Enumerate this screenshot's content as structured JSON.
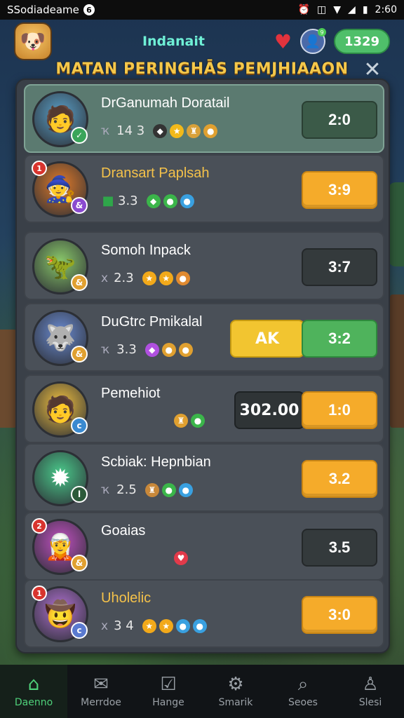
{
  "status_bar": {
    "app_name": "SSodiadeame",
    "app_badge": "6",
    "time": "2:60",
    "icons": [
      "alarm-icon",
      "vibrate-icon",
      "wifi-icon",
      "signal-icon",
      "battery-icon"
    ]
  },
  "header": {
    "title": "Indanait",
    "coins": "1329",
    "profile_badge": "9"
  },
  "banner": {
    "title": "MATAN PERINGHĀS PEMJHIAAON"
  },
  "rows": [
    {
      "name": "DrGanumah Doratail",
      "stat_prefix": "ҡ",
      "stat_value": "14 3",
      "score": "2:0",
      "score_style": "darkgreen",
      "active": true,
      "avatar_color": "#5aa0c8",
      "avatar_glyph": "🧑",
      "badge": "✓",
      "badge_color": "#3aa55a",
      "badge_top": "",
      "gems": [
        "◆",
        "★",
        "♜",
        "●"
      ],
      "gem_colors": [
        "#333",
        "#f2b91a",
        "#d9a13a",
        "#e0a030"
      ]
    },
    {
      "name": "Dransart Paplsah",
      "stat_prefix": "",
      "stat_value": "3.3",
      "score": "3:9",
      "score_style": "orange",
      "active": false,
      "name_gold": true,
      "avatar_color": "#e07a2a",
      "avatar_glyph": "🧙",
      "badge": "&",
      "badge_color": "#8a4ad0",
      "badge_top": "1",
      "gems": [
        "◆",
        "●",
        "●"
      ],
      "gem_colors": [
        "#3bb54a",
        "#3bb54a",
        "#39a0e0"
      ],
      "lead_gem": "■",
      "lead_gem_color": "#2fa64a"
    },
    {
      "name": "Somoh Inpack",
      "stat_prefix": "x",
      "stat_value": "2.3",
      "score": "3:7",
      "score_style": "dark",
      "active": false,
      "avatar_color": "#8ac86a",
      "avatar_glyph": "🦖",
      "badge": "&",
      "badge_color": "#e0a030",
      "badge_top": "",
      "gems": [
        "★",
        "★",
        "●"
      ],
      "gem_colors": [
        "#f2a91a",
        "#f2a91a",
        "#e08a30"
      ]
    },
    {
      "name": "DuGtrc Pmikalal",
      "stat_prefix": "ҡ",
      "stat_value": "3.3",
      "score": "3:2",
      "score_style": "green",
      "extra": "AK",
      "extra_style": "yellow",
      "active": false,
      "avatar_color": "#6a8ad0",
      "avatar_glyph": "🐺",
      "badge": "&",
      "badge_color": "#e0a030",
      "badge_top": "",
      "gems": [
        "◆",
        "●",
        "●"
      ],
      "gem_colors": [
        "#b050e0",
        "#e0a030",
        "#e0a030"
      ]
    },
    {
      "name": "Pemehiot",
      "stat_prefix": "",
      "stat_value": "",
      "score": "1:0",
      "score_style": "orange",
      "extra": "302.00",
      "extra_style": "dark",
      "active": false,
      "avatar_color": "#f0c040",
      "avatar_glyph": "🧑",
      "badge": "c",
      "badge_color": "#3a8ad0",
      "badge_top": "",
      "gems": [
        "♜",
        "●"
      ],
      "gem_colors": [
        "#e0a030",
        "#3bb54a"
      ]
    },
    {
      "name": "Scbiak: Hepnbian",
      "stat_prefix": "ҡ",
      "stat_value": "2.5",
      "score": "3.2",
      "score_style": "orange",
      "active": false,
      "avatar_color": "#4ac88a",
      "avatar_glyph": "✹",
      "badge": "l",
      "badge_color": "#2c5a3a",
      "badge_top": "",
      "gems": [
        "♜",
        "●",
        "●"
      ],
      "gem_colors": [
        "#c8883a",
        "#3bb54a",
        "#39a0e0"
      ]
    },
    {
      "name": "Goaias",
      "stat_prefix": "",
      "stat_value": "",
      "score": "3.5",
      "score_style": "dark",
      "active": false,
      "avatar_color": "#c050c0",
      "avatar_glyph": "🧝",
      "badge": "&",
      "badge_color": "#e0a030",
      "badge_top": "2",
      "gems": [
        "♥"
      ],
      "gem_colors": [
        "#e23a4a"
      ]
    },
    {
      "name": "Uholelic",
      "stat_prefix": "x",
      "stat_value": "3 4",
      "score": "3:0",
      "score_style": "orange",
      "active": false,
      "name_gold": true,
      "avatar_color": "#b070d0",
      "avatar_glyph": "🤠",
      "badge": "c",
      "badge_color": "#5a7ad0",
      "badge_top": "1",
      "gems": [
        "★",
        "★",
        "●",
        "●"
      ],
      "gem_colors": [
        "#f2a91a",
        "#f2a91a",
        "#39a0e0",
        "#39a0e0"
      ]
    }
  ],
  "nav": [
    {
      "label": "Daenno",
      "icon": "home-icon",
      "active": true
    },
    {
      "label": "Merrdoe",
      "icon": "mail-icon",
      "active": false
    },
    {
      "label": "Hange",
      "icon": "inbox-icon",
      "active": false
    },
    {
      "label": "Smarik",
      "icon": "gear-icon",
      "active": false
    },
    {
      "label": "Seoes",
      "icon": "search-icon",
      "active": false
    },
    {
      "label": "Slesi",
      "icon": "profile-icon",
      "active": false
    }
  ]
}
